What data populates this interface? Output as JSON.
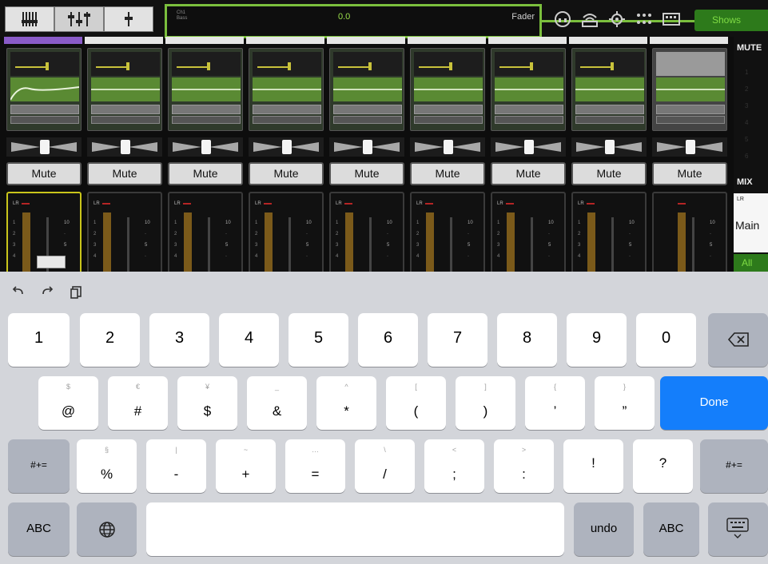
{
  "app": {
    "view_buttons": [
      "mixer-view",
      "channel-view",
      "single-fader-view"
    ],
    "fader_display": {
      "channel_info": [
        "Ch1",
        "Bass"
      ],
      "value": "0.0",
      "label": "Fader"
    },
    "top_icons": [
      "headphone-icon",
      "router-icon",
      "settings-gear-icon",
      "grid-dots-icon",
      "keyboard-grid-icon"
    ],
    "shows_label": "Shows",
    "accent_color": "#7bbf3d"
  },
  "channels": [
    {
      "mute_label": "Mute",
      "meter_label": "LR",
      "ticks": [
        "10",
        "",
        "5",
        ""
      ]
    },
    {
      "mute_label": "Mute",
      "meter_label": "LR",
      "ticks": [
        "10",
        "",
        "5",
        ""
      ]
    },
    {
      "mute_label": "Mute",
      "meter_label": "LR",
      "ticks": [
        "10",
        "",
        "5",
        ""
      ]
    },
    {
      "mute_label": "Mute",
      "meter_label": "LR",
      "ticks": [
        "10",
        "",
        "5",
        ""
      ]
    },
    {
      "mute_label": "Mute",
      "meter_label": "LR",
      "ticks": [
        "10",
        "",
        "5",
        ""
      ]
    },
    {
      "mute_label": "Mute",
      "meter_label": "LR",
      "ticks": [
        "10",
        "",
        "5",
        ""
      ]
    },
    {
      "mute_label": "Mute",
      "meter_label": "LR",
      "ticks": [
        "10",
        "",
        "5",
        ""
      ]
    },
    {
      "mute_label": "Mute",
      "meter_label": "LR",
      "ticks": [
        "10",
        "",
        "5",
        ""
      ]
    },
    {
      "mute_label": "Mute",
      "meter_label": "",
      "ticks": [
        "10",
        "",
        "5",
        ""
      ]
    }
  ],
  "right_panel": {
    "mute_header": "MUTE",
    "mix_header": "MIX",
    "main_sub": "LR",
    "main_label": "Main",
    "all_label": "All"
  },
  "keyboard": {
    "tools": [
      "undo-arrow-icon",
      "redo-arrow-icon",
      "paste-icon"
    ],
    "row1": [
      "1",
      "2",
      "3",
      "4",
      "5",
      "6",
      "7",
      "8",
      "9",
      "0"
    ],
    "row2": [
      {
        "main": "@",
        "alt": "$"
      },
      {
        "main": "#",
        "alt": "€"
      },
      {
        "main": "$",
        "alt": "¥"
      },
      {
        "main": "&",
        "alt": "_"
      },
      {
        "main": "*",
        "alt": "^"
      },
      {
        "main": "(",
        "alt": "["
      },
      {
        "main": ")",
        "alt": "]"
      },
      {
        "main": "’",
        "alt": "{"
      },
      {
        "main": "”",
        "alt": "}"
      }
    ],
    "row3": [
      {
        "main": "%",
        "alt": "§"
      },
      {
        "main": "-",
        "alt": "|"
      },
      {
        "main": "+",
        "alt": "~"
      },
      {
        "main": "=",
        "alt": "…"
      },
      {
        "main": "/",
        "alt": "\\"
      },
      {
        "main": ";",
        "alt": "<"
      },
      {
        "main": ":",
        "alt": ">"
      },
      {
        "main": "!",
        "alt": ""
      },
      {
        "main": "?",
        "alt": ""
      }
    ],
    "shift_label": "#+=",
    "done_label": "Done",
    "abc_label": "ABC",
    "undo_label": "undo",
    "delete_icon": "delete-backspace-icon",
    "globe_icon": "globe-icon",
    "dismiss_icon": "keyboard-dismiss-icon",
    "done_color": "#147efb"
  }
}
